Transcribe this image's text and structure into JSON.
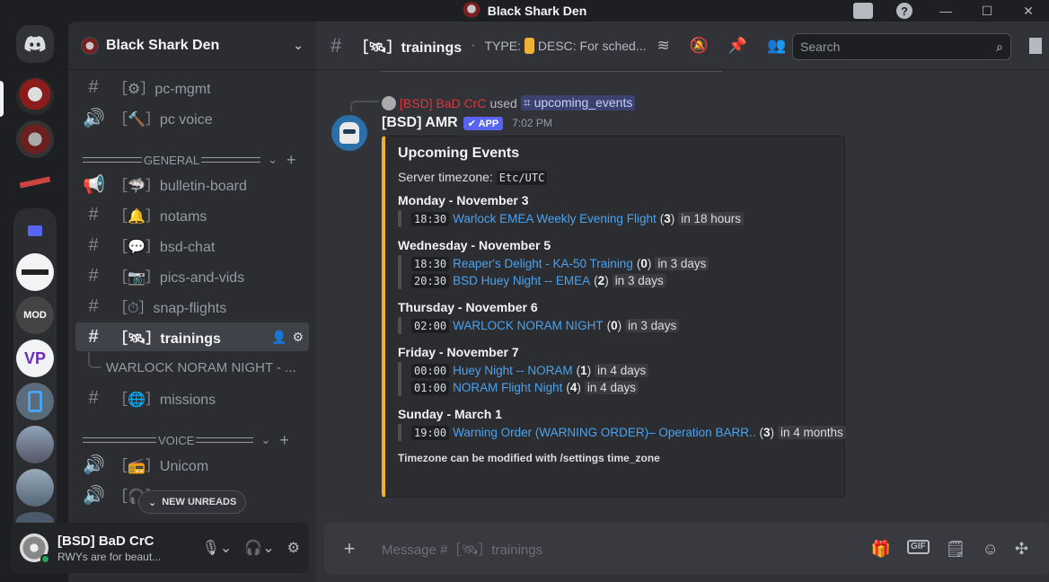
{
  "window": {
    "title": "Black Shark Den"
  },
  "server": {
    "name": "Black Shark Den"
  },
  "sidebar": {
    "items": [
      {
        "icon": "text-channel-icon",
        "label": "［⚙］pc-mgmt"
      },
      {
        "icon": "voice-channel-icon",
        "label": "［🔨］pc voice"
      },
      {
        "icon": "announcement-icon",
        "label": "［🦈］bulletin-board"
      },
      {
        "icon": "text-channel-icon",
        "label": "［🔔］notams"
      },
      {
        "icon": "text-channel-icon",
        "label": "［💬］bsd-chat"
      },
      {
        "icon": "text-channel-icon",
        "label": "［📷］pics-and-vids"
      },
      {
        "icon": "text-channel-icon",
        "label": "［⏱］snap-flights"
      },
      {
        "icon": "text-channel-icon",
        "label": "［🛰］trainings"
      },
      {
        "icon": "text-channel-icon",
        "label": "［🌐］missions"
      },
      {
        "icon": "voice-channel-icon",
        "label": "［📻］Unicom"
      },
      {
        "icon": "voice-channel-icon",
        "label": "［🎧］Com..."
      }
    ],
    "categories": [
      "GENERAL",
      "VOICE"
    ],
    "thread": "WARLOCK NORAM NIGHT - ...",
    "new_unreads": "NEW UNREADS"
  },
  "user": {
    "name": "[BSD] BaD CrC",
    "status": "RWYs are for beaut..."
  },
  "channel": {
    "name": "［🛰］trainings",
    "topic_type": "TYPE:",
    "topic_desc": "DESC: For sched..."
  },
  "search": {
    "placeholder": "Search"
  },
  "message": {
    "reply_author": "[BSD] BaD CrC",
    "reply_used": "used",
    "reply_command": "upcoming_events",
    "author": "[BSD] AMR",
    "app_badge": "✔ APP",
    "time": "7:02 PM",
    "embed": {
      "title": "Upcoming Events",
      "timezone_label": "Server timezone:",
      "timezone": "Etc/UTC",
      "days": [
        {
          "name": "Monday - November 3",
          "events": [
            {
              "time": "18:30",
              "title": "Warlock EMEA Weekly Evening Flight",
              "count": "3",
              "rel": "in 18 hours"
            }
          ]
        },
        {
          "name": "Wednesday - November 5",
          "events": [
            {
              "time": "18:30",
              "title": "Reaper's Delight - KA-50 Training",
              "count": "0",
              "rel": "in 3 days"
            },
            {
              "time": "20:30",
              "title": "BSD Huey Night -- EMEA",
              "count": "2",
              "rel": "in 3 days"
            }
          ]
        },
        {
          "name": "Thursday - November 6",
          "events": [
            {
              "time": "02:00",
              "title": "WARLOCK NORAM NIGHT",
              "count": "0",
              "rel": "in 3 days"
            }
          ]
        },
        {
          "name": "Friday - November 7",
          "events": [
            {
              "time": "00:00",
              "title": "Huey Night -- NORAM",
              "count": "1",
              "rel": "in 4 days"
            },
            {
              "time": "01:00",
              "title": "NORAM Flight Night",
              "count": "4",
              "rel": "in 4 days"
            }
          ]
        },
        {
          "name": "Sunday - March 1",
          "events": [
            {
              "time": "19:00",
              "title": "Warning Order (WARNING ORDER)– Operation BARR..",
              "count": "3",
              "rel": "in 4 months"
            }
          ]
        }
      ],
      "footer": "Timezone can be modified with /settings time_zone"
    }
  },
  "composer": {
    "placeholder": "Message #［🛰］trainings"
  },
  "colors": {
    "accent": "#5865f2",
    "embed_bar": "#f0b232",
    "link": "#4aa3f0"
  }
}
